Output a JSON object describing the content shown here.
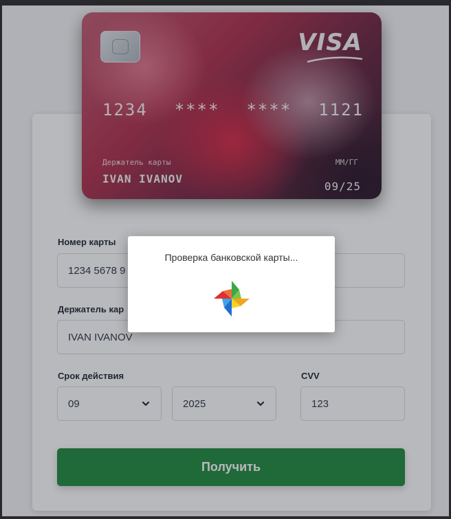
{
  "card": {
    "brand": "VISA",
    "number_groups": [
      "1234",
      "****",
      "****",
      "1121"
    ],
    "holder_caption": "Держатель карты",
    "holder_name": "IVAN IVANOV",
    "expiry_caption": "ММ/ГГ",
    "expiry_value": "09/25"
  },
  "form": {
    "card_number": {
      "label": "Номер карты",
      "value": "1234 5678 9"
    },
    "card_holder": {
      "label": "Держатель кар",
      "value": "IVAN IVANOV"
    },
    "expiry": {
      "label": "Срок действия",
      "month": "09",
      "year": "2025"
    },
    "cvv": {
      "label": "CVV",
      "value": "123"
    },
    "submit_label": "Получить"
  },
  "modal": {
    "message": "Проверка банковской карты..."
  },
  "icons": {
    "spinner": "pinwheel-spinner-icon",
    "chevron": "chevron-down-icon",
    "chip": "card-chip-icon"
  },
  "colors": {
    "submit": "#1f8a3e",
    "card_primary": "#b0304e",
    "card_dark": "#2d1c2c"
  }
}
